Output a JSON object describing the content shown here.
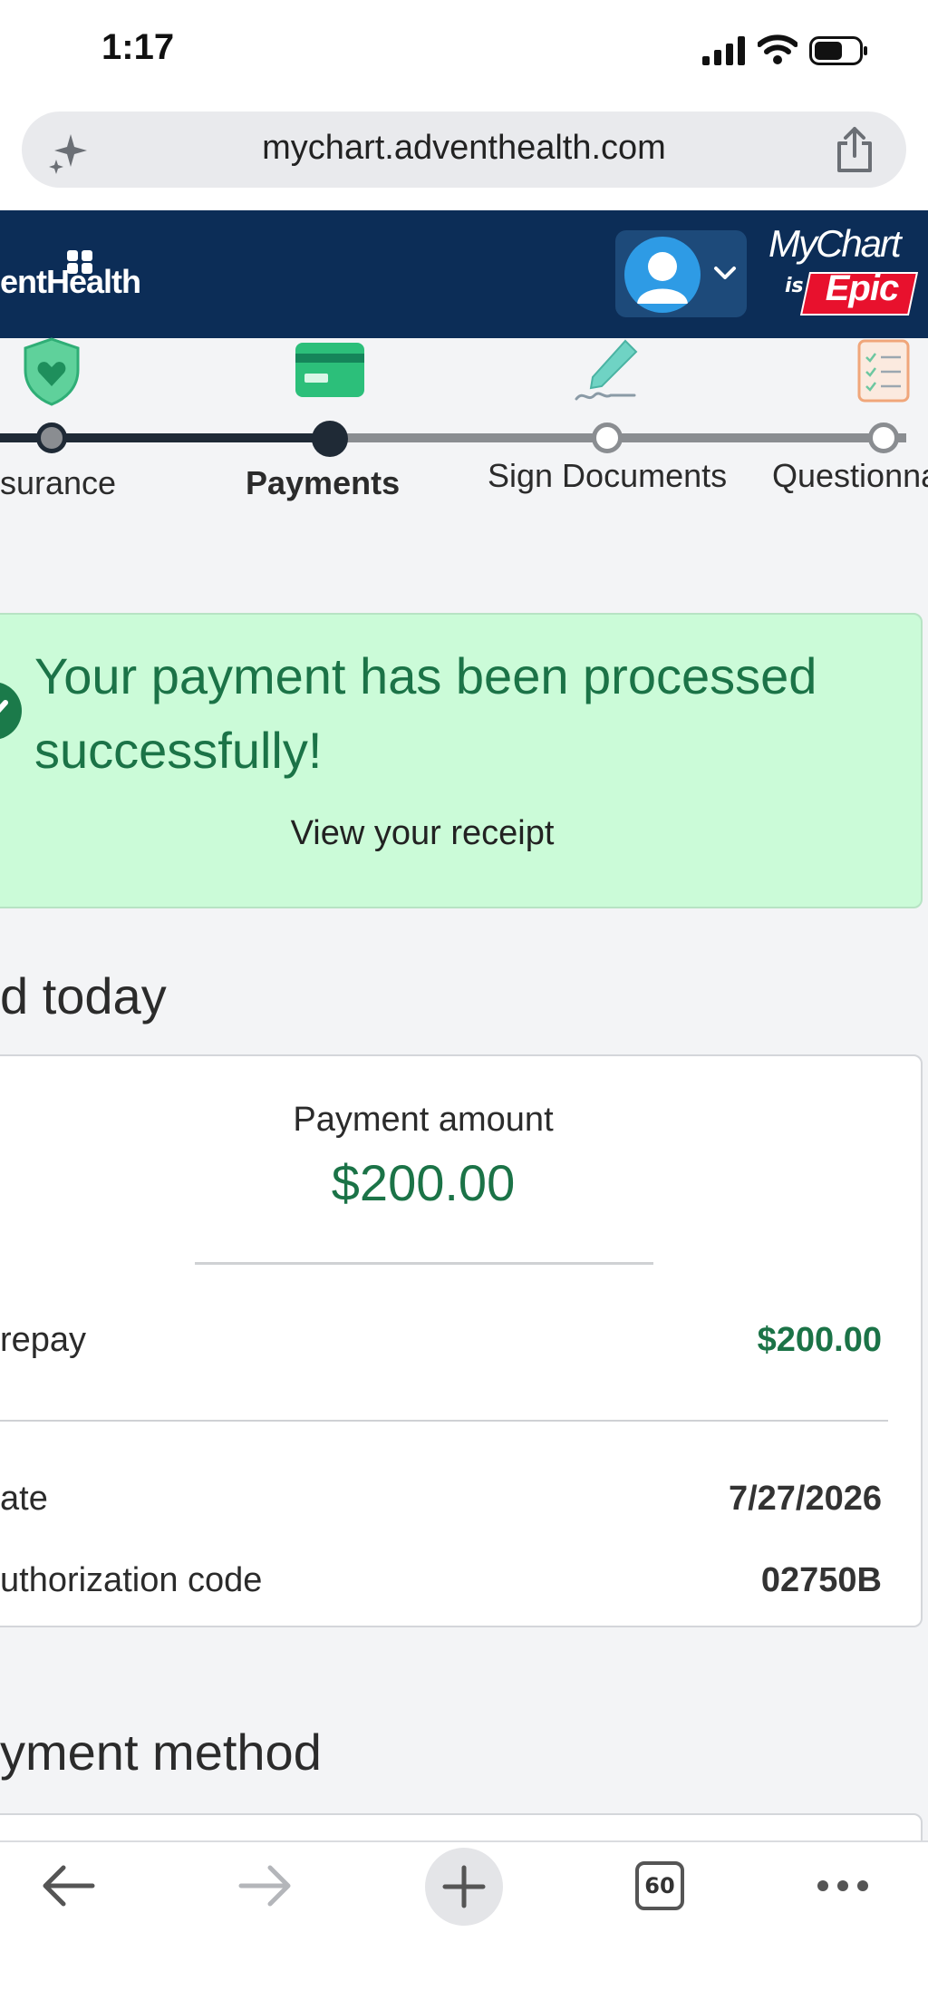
{
  "status_bar": {
    "time": "1:17"
  },
  "browser": {
    "url": "mychart.adventhealth.com",
    "tab_count": "60"
  },
  "header": {
    "brand": "entHealth",
    "logo_line1": "MyChart",
    "logo_is": "is",
    "logo_epic": "Epic"
  },
  "steps": [
    {
      "label": "surance",
      "state": "completed"
    },
    {
      "label": "Payments",
      "state": "current"
    },
    {
      "label": "Sign Documents",
      "state": "upcoming"
    },
    {
      "label": "Questionna",
      "state": "upcoming"
    }
  ],
  "banner": {
    "title": "Your payment has been processed successfully!",
    "link": "View your receipt"
  },
  "paid_section": {
    "title": "d today",
    "amount_label": "Payment amount",
    "amount_value": "$200.00",
    "rows": [
      {
        "label": "repay",
        "value": "$200.00"
      },
      {
        "label": "ate",
        "value": "7/27/2026"
      },
      {
        "label": "uthorization code",
        "value": "02750B"
      }
    ]
  },
  "method_section": {
    "title": "yment method"
  },
  "colors": {
    "header_bg": "#0c2d57",
    "success_bg": "#cbfbd8",
    "success_text": "#1b7347",
    "epic_red": "#e8112d"
  }
}
